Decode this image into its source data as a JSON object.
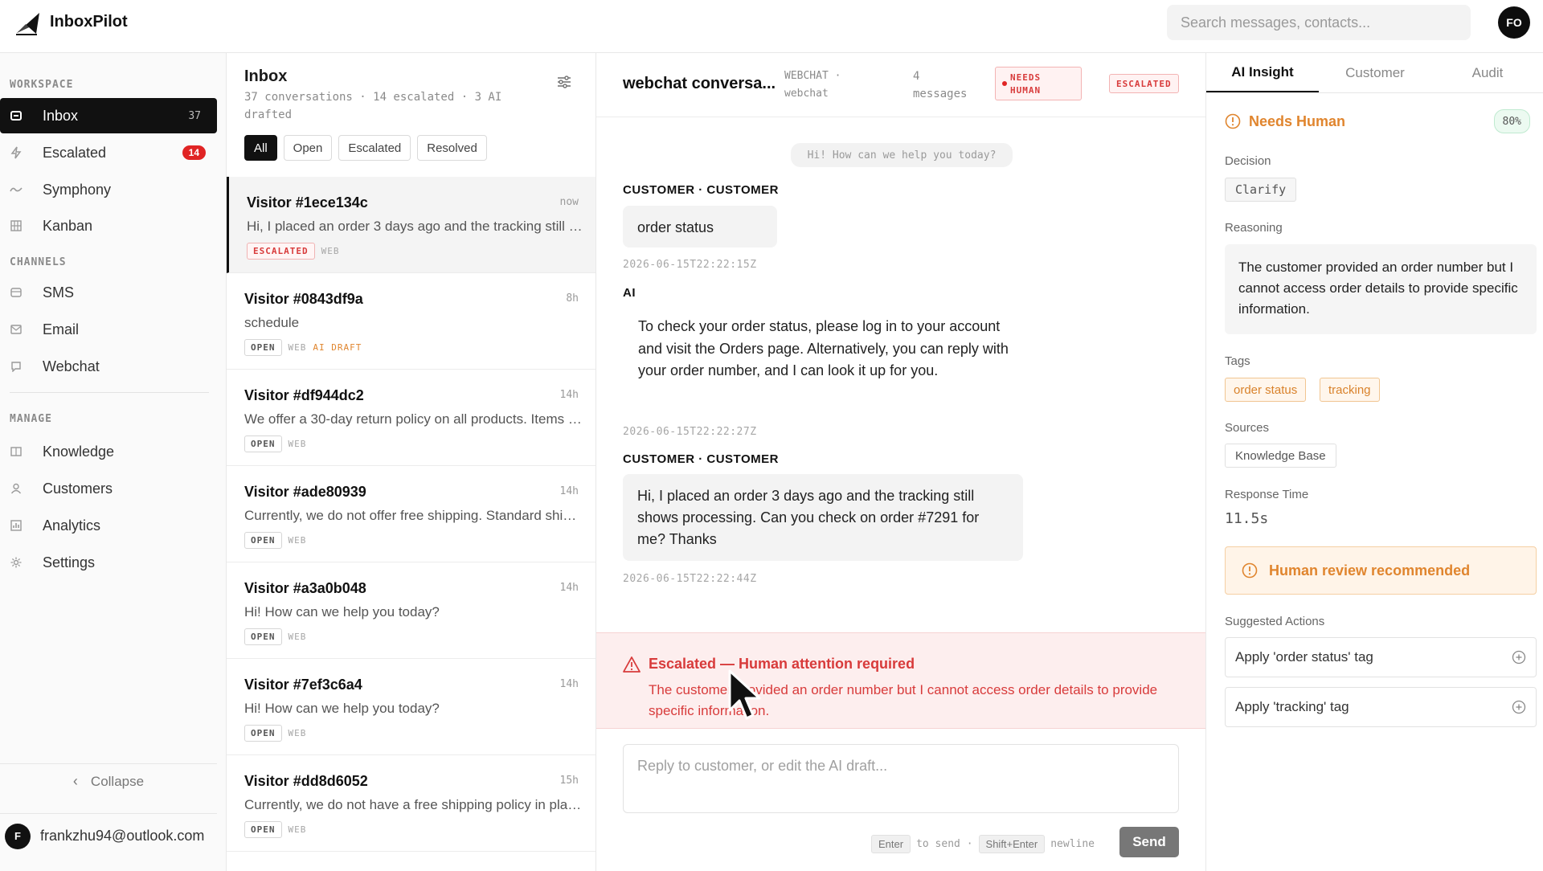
{
  "app": {
    "name": "InboxPilot"
  },
  "header": {
    "search_placeholder": "Search messages, contacts...",
    "avatar_initials": "FO"
  },
  "sidebar": {
    "workspace_label": "WORKSPACE",
    "channels_label": "CHANNELS",
    "manage_label": "MANAGE",
    "workspace_items": [
      {
        "label": "Inbox",
        "count": "37",
        "icon": "inbox-icon"
      },
      {
        "label": "Escalated",
        "count": "14",
        "icon": "bolt-icon"
      },
      {
        "label": "Symphony",
        "icon": "wave-icon"
      },
      {
        "label": "Kanban",
        "icon": "grid-icon"
      }
    ],
    "channel_items": [
      {
        "label": "SMS",
        "icon": "sms-icon"
      },
      {
        "label": "Email",
        "icon": "mail-icon"
      },
      {
        "label": "Webchat",
        "icon": "chat-icon"
      }
    ],
    "manage_items": [
      {
        "label": "Knowledge",
        "icon": "book-icon"
      },
      {
        "label": "Customers",
        "icon": "user-icon"
      },
      {
        "label": "Analytics",
        "icon": "chart-icon"
      },
      {
        "label": "Settings",
        "icon": "gear-icon"
      }
    ],
    "collapse_label": "Collapse",
    "user": {
      "initial": "F",
      "email": "frankzhu94@outlook.com"
    }
  },
  "inbox": {
    "title": "Inbox",
    "subtitle": "37 conversations · 14 escalated · 3 AI drafted",
    "filters": [
      "All",
      "Open",
      "Escalated",
      "Resolved"
    ],
    "conversations": [
      {
        "name": "Visitor #1ece134c",
        "time": "now",
        "preview": "Hi, I placed an order 3 days ago and the tracking still shows processing. Can you check on order #7291 for me? Thanks",
        "status": "ESCALATED",
        "channel": "WEB",
        "ai": ""
      },
      {
        "name": "Visitor #0843df9a",
        "time": "8h",
        "preview": "schedule",
        "status": "OPEN",
        "channel": "WEB",
        "ai": "AI DRAFT"
      },
      {
        "name": "Visitor #df944dc2",
        "time": "14h",
        "preview": "We offer a 30-day return policy on all products. Items must be unused.",
        "status": "OPEN",
        "channel": "WEB",
        "ai": ""
      },
      {
        "name": "Visitor #ade80939",
        "time": "14h",
        "preview": "Currently, we do not offer free shipping. Standard shipping rates apply.",
        "status": "OPEN",
        "channel": "WEB",
        "ai": ""
      },
      {
        "name": "Visitor #a3a0b048",
        "time": "14h",
        "preview": "Hi! How can we help you today?",
        "status": "OPEN",
        "channel": "WEB",
        "ai": ""
      },
      {
        "name": "Visitor #7ef3c6a4",
        "time": "14h",
        "preview": "Hi! How can we help you today?",
        "status": "OPEN",
        "channel": "WEB",
        "ai": ""
      },
      {
        "name": "Visitor #dd8d6052",
        "time": "15h",
        "preview": "Currently, we do not have a free shipping policy in place for orders.",
        "status": "OPEN",
        "channel": "WEB",
        "ai": ""
      }
    ]
  },
  "conversation": {
    "title": "webchat conversa...",
    "channel_line1": "WEBCHAT ·",
    "channel_line2": "webchat",
    "count_line1": "4",
    "count_line2": "messages",
    "needs_human_line1": "NEEDS",
    "needs_human_line2": "HUMAN",
    "status_badge": "ESCALATED",
    "system_message": "Hi! How can we help you today?",
    "messages": [
      {
        "sender": "CUSTOMER · CUSTOMER",
        "text": "order status",
        "timestamp": "2026-06-15T22:22:15Z"
      },
      {
        "sender": "AI",
        "text": "To check your order status, please log in to your account and visit the Orders page. Alternatively, you can reply with your order number, and I can look it up for you.",
        "timestamp": "2026-06-15T22:22:27Z"
      },
      {
        "sender": "CUSTOMER · CUSTOMER",
        "text": "Hi, I placed an order 3 days ago and the tracking still shows processing. Can you check on order #7291 for me? Thanks",
        "timestamp": "2026-06-15T22:22:44Z"
      }
    ],
    "escalation_title": "Escalated — Human attention required",
    "escalation_body": "The customer provided an order number but I cannot access order details to provide specific information.",
    "reply_placeholder": "Reply to customer, or edit the AI draft...",
    "hint_enter": "Enter",
    "hint_to_send": "to send ·",
    "hint_shift_enter": "Shift+Enter",
    "hint_newline": "newline",
    "send_label": "Send"
  },
  "insight": {
    "tabs": [
      "AI Insight",
      "Customer",
      "Audit"
    ],
    "status": "Needs Human",
    "confidence": "80%",
    "decision_label": "Decision",
    "decision": "Clarify",
    "reasoning_label": "Reasoning",
    "reasoning": "The customer provided an order number but I cannot access order details to provide specific information.",
    "tags_label": "Tags",
    "tags": [
      "order status",
      "tracking"
    ],
    "sources_label": "Sources",
    "sources": [
      "Knowledge Base"
    ],
    "response_time_label": "Response Time",
    "response_time": "11.5s",
    "review_text": "Human review recommended",
    "suggested_label": "Suggested Actions",
    "suggested_actions": [
      "Apply 'order status' tag",
      "Apply 'tracking' tag"
    ]
  },
  "colors": {
    "accent_black": "#111111",
    "escalation_red": "#d83b3b",
    "warning_orange": "#e0852e"
  }
}
